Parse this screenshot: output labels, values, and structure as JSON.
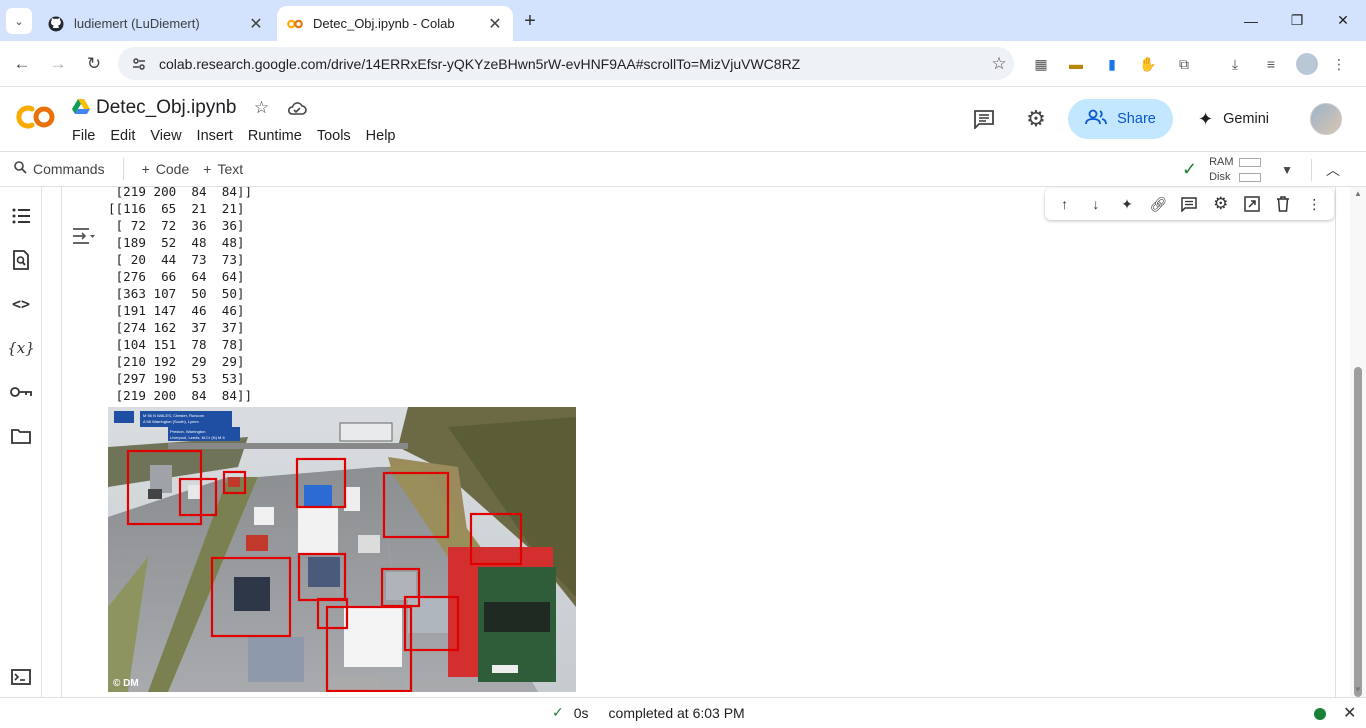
{
  "browser": {
    "tabs": [
      {
        "title": "ludiemert (LuDiemert)",
        "icon": "github-icon",
        "active": false
      },
      {
        "title": "Detec_Obj.ipynb - Colab",
        "icon": "colab-icon",
        "active": true
      }
    ],
    "url": "colab.research.google.com/drive/14ERRxEfsr-yQKYzeBHwn5rW-evHNF9AA#scrollTo=MizVjuVWC8RZ"
  },
  "notebook": {
    "title": "Detec_Obj.ipynb",
    "menu": [
      "File",
      "Edit",
      "View",
      "Insert",
      "Runtime",
      "Tools",
      "Help"
    ],
    "share_label": "Share",
    "gemini_label": "Gemini"
  },
  "toolbar": {
    "commands_label": "Commands",
    "code_label": "Code",
    "text_label": "Text",
    "ram_label": "RAM",
    "disk_label": "Disk"
  },
  "output": {
    "top_line": " [219 200  84  84]]",
    "lines": [
      "[[116  65  21  21]",
      " [ 72  72  36  36]",
      " [189  52  48  48]",
      " [ 20  44  73  73]",
      " [276  66  64  64]",
      " [363 107  50  50]",
      " [191 147  46  46]",
      " [274 162  37  37]",
      " [104 151  78  78]",
      " [210 192  29  29]",
      " [297 190  53  53]",
      " [219 200  84  84]]"
    ],
    "image_watermark": "© DM",
    "sign_text_1": "M 56  N WALES, Chester, Runcorn",
    "sign_text_2": "A 56  Warrington (South), Lymm",
    "sign_text_3": "Preston, Warrington",
    "sign_text_4": "Liverpool, Leeds, M.Cr (N)   M 6"
  },
  "status": {
    "duration": "0s",
    "completed": "completed at 6:03 PM"
  },
  "colors": {
    "tabstrip": "#d3e3fd",
    "share_bg": "#c2e7ff",
    "accent_green": "#188038",
    "box_red": "#e00000"
  }
}
